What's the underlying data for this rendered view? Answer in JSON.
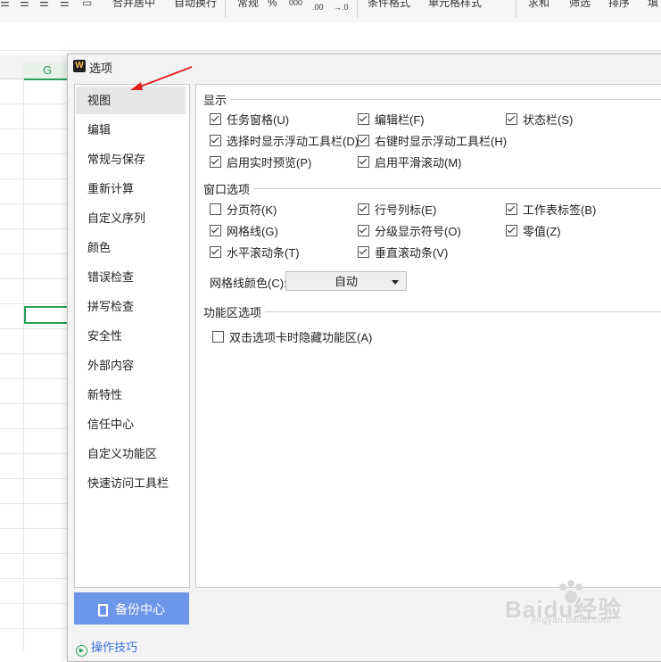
{
  "ribbon": {
    "merge_center": "合并居中",
    "auto_wrap": "自动换行",
    "number_format": "常规",
    "percent": "%",
    "thousands": "000",
    "inc_decimal": ".00",
    "dec_decimal": "→.0",
    "cond_format": "条件格式",
    "cell_style": "单元格样式",
    "sum": "求和",
    "filter": "筛选",
    "sort": "排序",
    "fill": "填"
  },
  "sheet": {
    "column_label": "G"
  },
  "dialog": {
    "title": "选项",
    "nav": [
      "视图",
      "编辑",
      "常规与保存",
      "重新计算",
      "自定义序列",
      "颜色",
      "错误检查",
      "拼写检查",
      "安全性",
      "外部内容",
      "新特性",
      "信任中心",
      "自定义功能区",
      "快速访问工具栏"
    ],
    "active_nav": "视图",
    "backup_button": "备份中心",
    "tips_link": "操作技巧",
    "sections": {
      "display": {
        "title": "显示",
        "options": [
          {
            "label": "任务窗格(U)",
            "checked": true
          },
          {
            "label": "编辑栏(F)",
            "checked": true
          },
          {
            "label": "状态栏(S)",
            "checked": true
          },
          {
            "label": "选择时显示浮动工具栏(D)",
            "checked": true
          },
          {
            "label": "右键时显示浮动工具栏(H)",
            "checked": true
          },
          {
            "label": "启用实时预览(P)",
            "checked": true
          },
          {
            "label": "启用平滑滚动(M)",
            "checked": true
          }
        ]
      },
      "window": {
        "title": "窗口选项",
        "options": [
          {
            "label": "分页符(K)",
            "checked": false
          },
          {
            "label": "行号列标(E)",
            "checked": true
          },
          {
            "label": "工作表标签(B)",
            "checked": true
          },
          {
            "label": "网格线(G)",
            "checked": true
          },
          {
            "label": "分级显示符号(O)",
            "checked": true
          },
          {
            "label": "零值(Z)",
            "checked": true
          },
          {
            "label": "水平滚动条(T)",
            "checked": true
          },
          {
            "label": "垂直滚动条(V)",
            "checked": true
          }
        ],
        "grid_color_label": "网格线颜色(C):",
        "grid_color_value": "自动"
      },
      "ribbon": {
        "title": "功能区选项",
        "options": [
          {
            "label": "双击选项卡时隐藏功能区(A)",
            "checked": false
          }
        ]
      }
    }
  },
  "watermark": {
    "brand": "Baidu经验",
    "url": "jingyan.baidu.com"
  },
  "colors": {
    "accent_blue": "#6d95e8",
    "link_blue": "#3a6fd8",
    "sheet_green": "#27a05a",
    "arrow_red": "#e02020"
  }
}
